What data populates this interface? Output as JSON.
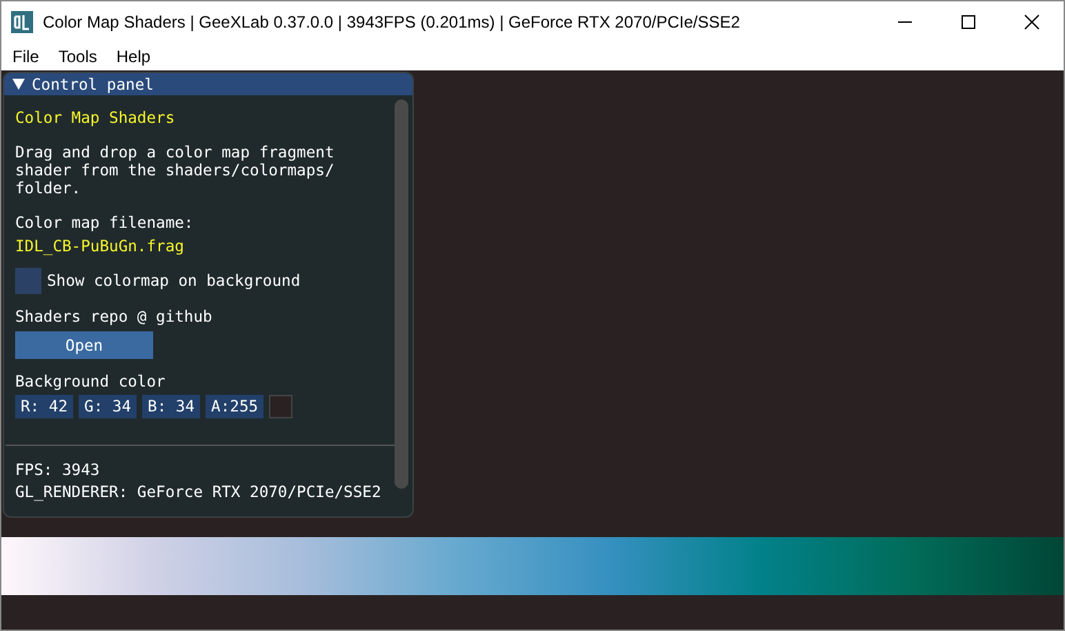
{
  "window": {
    "title": "Color Map Shaders | GeeXLab 0.37.0.0 | 3943FPS (0.201ms) | GeForce RTX 2070/PCIe/SSE2"
  },
  "menu": [
    "File",
    "Tools",
    "Help"
  ],
  "panel": {
    "title": "Control panel",
    "expanded": true,
    "heading": "Color Map Shaders",
    "description": "Drag and drop a color map fragment shader from the shaders/colormaps/ folder.",
    "filename_label": "Color map filename:",
    "filename": "IDL_CB-PuBuGn.frag",
    "checkbox": {
      "label": "Show colormap on background",
      "checked": false
    },
    "repo_label": "Shaders repo @ github",
    "open_button": "Open",
    "background_color": {
      "label": "Background color",
      "color": "#2a2222",
      "fields": [
        "R: 42",
        "G: 34",
        "B: 34",
        "A:255"
      ]
    },
    "fps": "FPS: 3943",
    "renderer": "GL_RENDERER: GeForce RTX 2070/PCIe/SSE2"
  }
}
